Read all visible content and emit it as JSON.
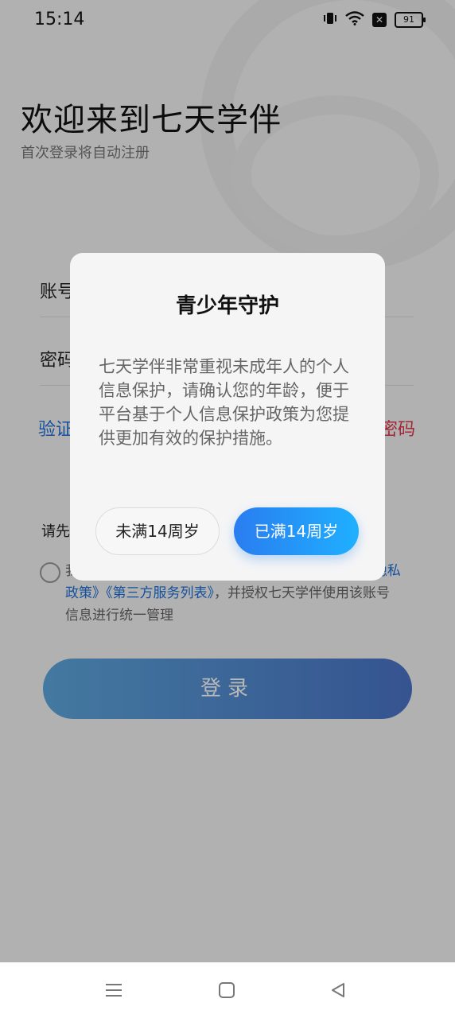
{
  "status_bar": {
    "time": "15:14",
    "battery": "91",
    "icons": [
      "vibrate-icon",
      "wifi-icon",
      "no-sim-icon",
      "battery-icon"
    ]
  },
  "page": {
    "welcome_title": "欢迎来到七天学伴",
    "subtitle": "首次登录将自动注册",
    "account_label": "账号",
    "password_label": "密码",
    "code_login_link": "验证",
    "forgot_password_link": "密码",
    "read_first_text": "请先",
    "agreement": {
      "fragment_start": "我",
      "link_privacy_tail": "隐私",
      "line2_links": "政策》《第三方服务列表》",
      "line2_text": "，并授权七天学伴使用该账号",
      "line3_text": "信息进行统一管理"
    },
    "login_button": "登录"
  },
  "dialog": {
    "title": "青少年守护",
    "body": "七天学伴非常重视未成年人的个人信息保护，请确认您的年龄，便于平台基于个人信息保护政策为您提供更加有效的保护措施。",
    "under_14_button": "未满14周岁",
    "over_14_button": "已满14周岁"
  },
  "navbar": {
    "icons": [
      "menu-icon",
      "home-icon",
      "back-icon"
    ]
  },
  "colors": {
    "primary": "#2a7df0",
    "link_blue": "#1e6fd9",
    "link_red": "#e0374a",
    "overlay": "rgba(0,0,0,0.28)"
  }
}
